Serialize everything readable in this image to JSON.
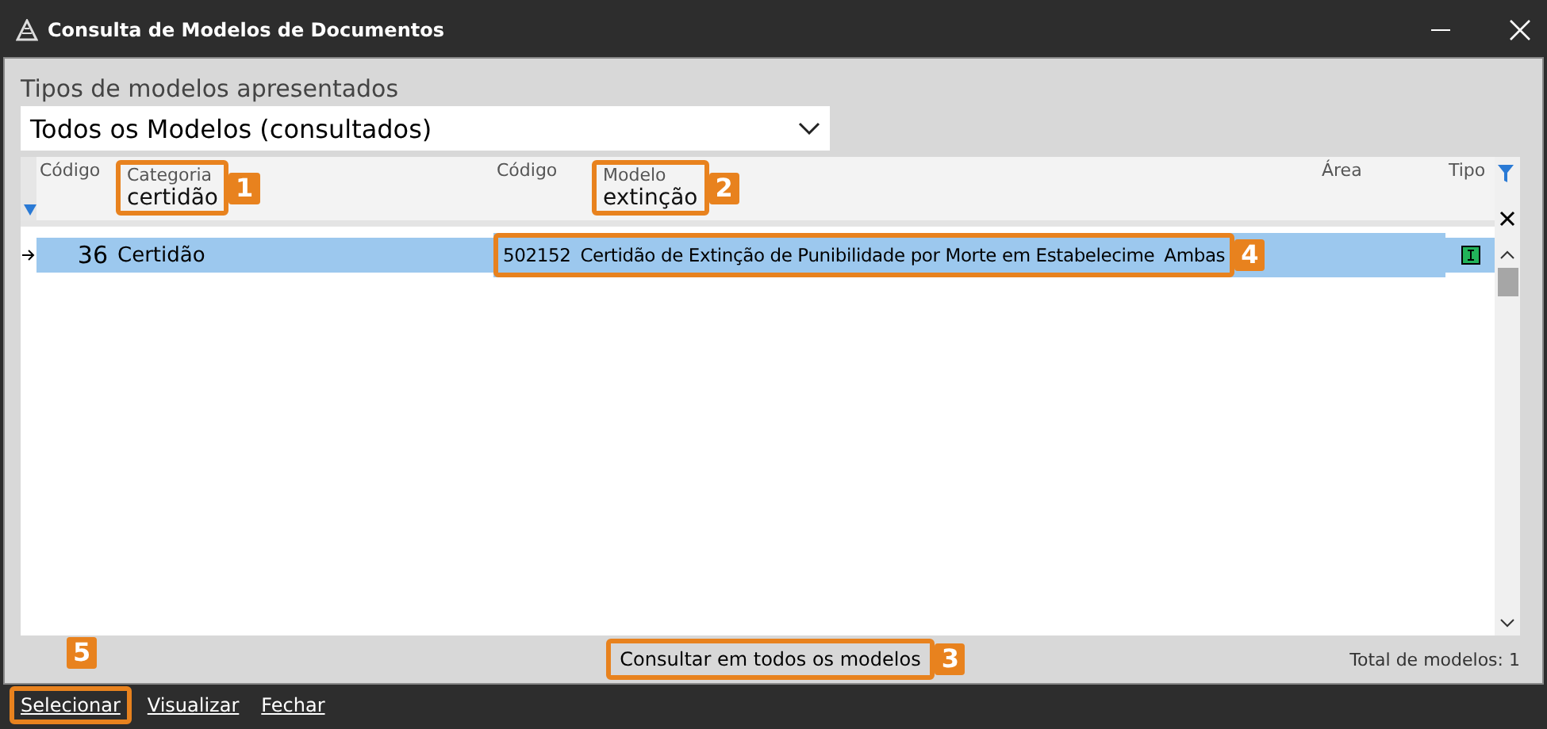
{
  "window": {
    "title": "Consulta de Modelos de Documentos"
  },
  "types_label": "Tipos de modelos apresentados",
  "types_select": {
    "value": "Todos os Modelos (consultados)"
  },
  "table": {
    "columns": [
      {
        "label": "Código"
      },
      {
        "label": "Categoria",
        "filter": "certidão",
        "callout": "1"
      },
      {
        "label": "Código"
      },
      {
        "label": "Modelo",
        "filter": "extinção",
        "callout": "2"
      },
      {
        "label": "Área"
      },
      {
        "label": "Tipo"
      }
    ],
    "rows": [
      {
        "selected": true,
        "cells": [
          "36",
          "Certidão",
          "502152",
          "Certidão de Extinção de Punibilidade por Morte em Estabelecime",
          "Ambas"
        ],
        "callout": "4"
      }
    ]
  },
  "query_button": {
    "label": "Consultar em todos os modelos",
    "callout": "3"
  },
  "total": "Total de modelos: 1",
  "footer_buttons": [
    {
      "label": "Selecionar",
      "callout": "5"
    },
    {
      "label": "Visualizar"
    },
    {
      "label": "Fechar"
    }
  ]
}
